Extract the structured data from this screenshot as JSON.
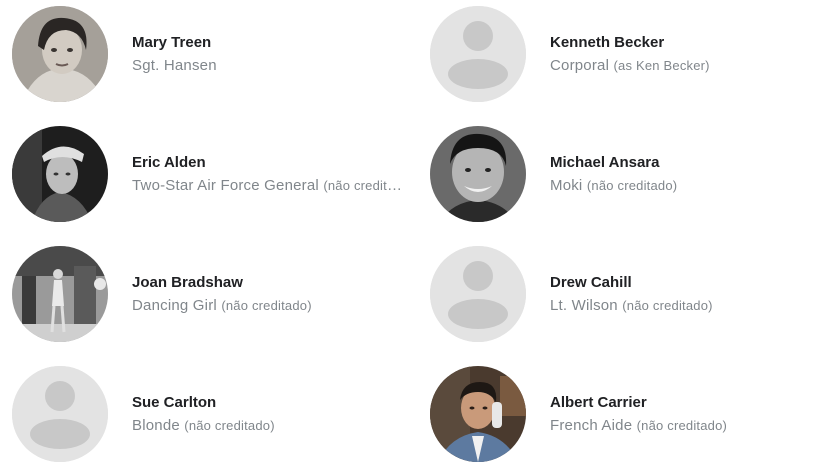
{
  "cast": [
    {
      "name": "Mary Treen",
      "role": "Sgt. Hansen",
      "note": "",
      "photo": "photo"
    },
    {
      "name": "Kenneth Becker",
      "role": "Corporal",
      "note": "(as Ken Becker)",
      "photo": "placeholder"
    },
    {
      "name": "Eric Alden",
      "role": "Two-Star Air Force General",
      "note": "(não creditado)",
      "photo": "photo"
    },
    {
      "name": "Michael Ansara",
      "role": "Moki",
      "note": "(não creditado)",
      "photo": "photo"
    },
    {
      "name": "Joan Bradshaw",
      "role": "Dancing Girl",
      "note": "(não creditado)",
      "photo": "photo"
    },
    {
      "name": "Drew Cahill",
      "role": "Lt. Wilson",
      "note": "(não creditado)",
      "photo": "placeholder"
    },
    {
      "name": "Sue Carlton",
      "role": "Blonde",
      "note": "(não creditado)",
      "photo": "placeholder"
    },
    {
      "name": "Albert Carrier",
      "role": "French Aide",
      "note": "(não creditado)",
      "photo": "photo"
    }
  ],
  "colors": {
    "name_text": "#202124",
    "role_text": "#80868b",
    "placeholder_bg": "#e3e3e3",
    "placeholder_fg": "#c8c8c8"
  }
}
